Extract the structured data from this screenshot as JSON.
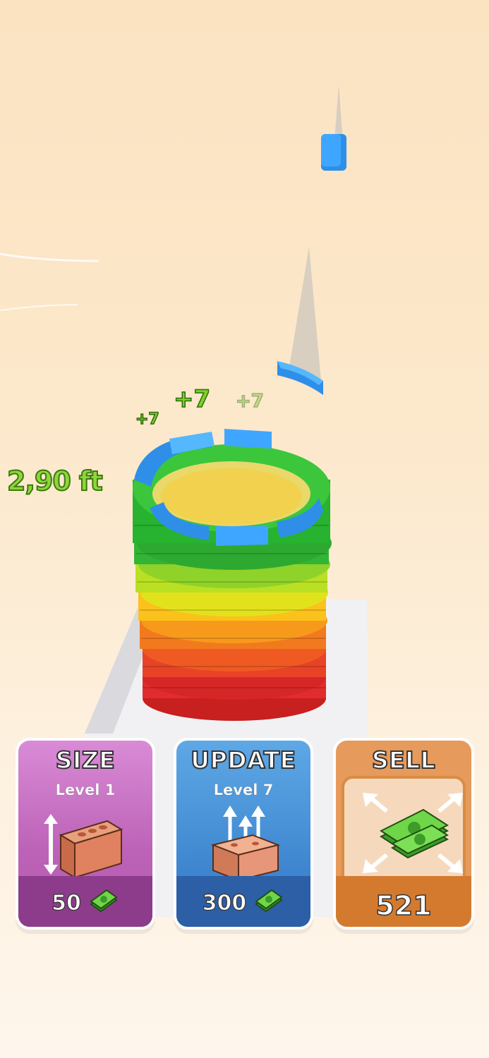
{
  "hud": {
    "height_label": "2,90 ft",
    "gain_popups": [
      "+7",
      "+7",
      "+7"
    ]
  },
  "cards": {
    "size": {
      "title": "SIZE",
      "level": "Level 1",
      "price": "50",
      "icon": "brick-height-icon"
    },
    "update": {
      "title": "UPDATE",
      "level": "Level 7",
      "price": "300",
      "icon": "brick-upgrade-icon"
    },
    "sell": {
      "title": "SELL",
      "amount": "521",
      "icon": "money-stack-icon"
    }
  },
  "colors": {
    "size_card": "#bc62b7",
    "update_card": "#3d86cf",
    "sell_card": "#e69a5b",
    "cash": "#5cc23a"
  }
}
